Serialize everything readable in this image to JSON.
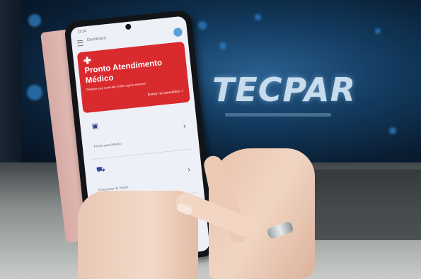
{
  "background": {
    "brand_text": "TECPAR"
  },
  "phone": {
    "status_time": "11:24",
    "app_title": "Dashboard",
    "menu_icon": "hamburger-menu-icon",
    "avatar_icon": "user-avatar-icon",
    "hero_card": {
      "icon": "plus-cross-icon",
      "title": "Pronto Atendimento Médico",
      "description": "Realize sua consulta online agora mesmo!",
      "cta_label": "Entrar no consultório",
      "cta_icon": "chevron-right-icon",
      "color": "#d92a2e"
    },
    "items": [
      {
        "label": "Pronto para Médico",
        "icon": "clipboard-icon"
      },
      {
        "label": "Programas de Saúde",
        "icon": "cart-icon"
      },
      {
        "label": "",
        "icon": "tag-icon"
      }
    ],
    "accent_color": "#2c3e8f"
  }
}
